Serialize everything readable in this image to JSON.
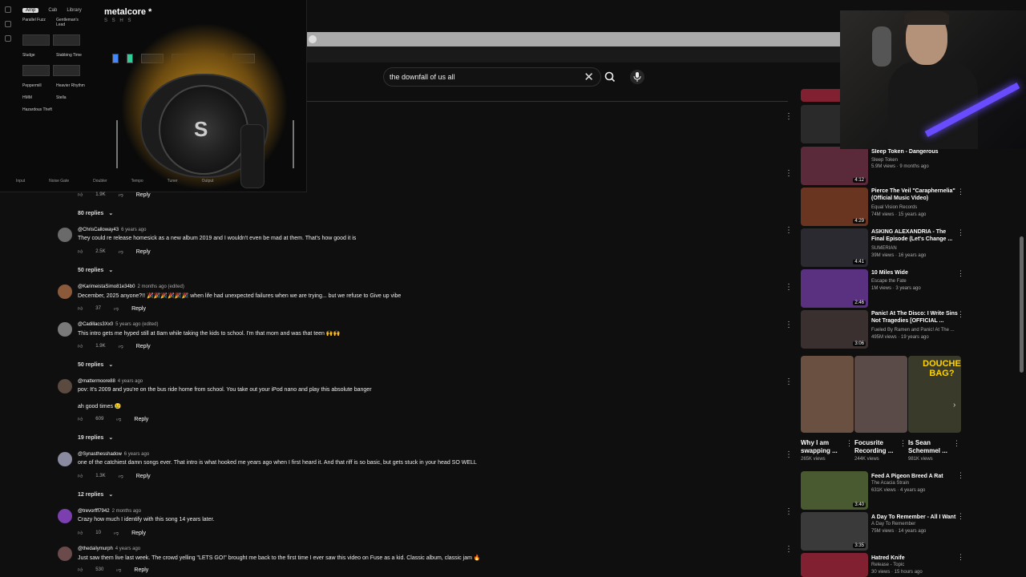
{
  "plugin": {
    "title": "metalcore *",
    "subtitle": "S  S  H  S",
    "tabs": [
      "Amp",
      "Cab",
      "Library"
    ],
    "presets": [
      {
        "a": "Parallel Fuzz",
        "b": "Gentleman's Lead"
      },
      {
        "a": "Sludge",
        "b": "Stabbing Time"
      },
      {
        "a": "Peppermill",
        "b": "Heavier Rhythm"
      },
      {
        "a": "HMM",
        "b": "Stella"
      },
      {
        "a": "Hazardous Theft",
        "b": ""
      }
    ],
    "logo": "S",
    "bottom_labels": [
      "Input",
      "Noise Gate",
      "Doubler",
      "Tempo",
      "Tuner",
      "Output"
    ]
  },
  "search": {
    "query": "the downfall of us all"
  },
  "comments": [
    {
      "id": "top",
      "likes": "1.9K",
      "reply": "Reply",
      "replies": "80 replies"
    },
    {
      "handle": "@ChrisCalloway43",
      "age": "6 years ago",
      "text": "They could re release homesick as a new album 2019 and I wouldn't even be mad at them. That's how good it is",
      "likes": "2.5K",
      "reply": "Reply",
      "replies": "50 replies"
    },
    {
      "handle": "@KarimeistaSimo81e34b0",
      "age": "2 months ago (edited)",
      "text": "December, 2025 anyone?!! 🎉🎉🎉🎉🎉🎉 when life had unexpected failures when we are trying... but we refuse to Give up vibe",
      "likes": "37",
      "reply": "Reply",
      "replies": ""
    },
    {
      "handle": "@Cadillacs3Xx0",
      "age": "5 years ago (edited)",
      "text": "This intro gets me hyped still at 8am while taking the kids to school. I'm that mom and was that teen 🙌🙌",
      "likes": "1.9K",
      "reply": "Reply",
      "replies": "50 replies"
    },
    {
      "handle": "@mattermoore88",
      "age": "4 years ago",
      "text": "pov: It's 2009 and you're on the bus ride home from school. You take out your iPod nano and play this absolute banger",
      "text2": "ah good times 😢",
      "likes": "609",
      "reply": "Reply",
      "replies": "19 replies"
    },
    {
      "handle": "@Synasthesshadow",
      "age": "6 years ago",
      "text": "one of the catchiest damn songs ever. That intro is what hooked me years ago when I first heard it. And that riff is so basic, but gets stuck in your head SO WELL",
      "likes": "1.3K",
      "reply": "Reply",
      "replies": "12 replies"
    },
    {
      "handle": "@trevorfff7942",
      "age": "2 months ago",
      "text": "Crazy how much I identify with this song 14 years later.",
      "likes": "10",
      "reply": "Reply",
      "replies": ""
    },
    {
      "handle": "@thedailymurph",
      "age": "4 years ago",
      "text": "Just saw them live last week. The crowd yelling \"LETS GO!\" brought me back to the first time I ever saw this video on Fuse as a kid. Classic album, classic jam 🔥",
      "likes": "530",
      "reply": "Reply",
      "replies": ""
    }
  ],
  "sidebar": [
    {
      "title": "Sleep Token - Dangerous",
      "channel": "Sleep Token",
      "meta": "5.9M views · 9 months ago",
      "duration": "4:12",
      "color": "#5a2a3a"
    },
    {
      "title": "Pierce The Veil \"Caraphernelia\" (Official Music Video)",
      "channel": "Equal Vision Records",
      "meta": "74M views · 15 years ago",
      "duration": "4:29",
      "color": "#6a3520"
    },
    {
      "title": "ASKING ALEXANDRIA - The Final Episode (Let's Change ...",
      "channel": "SUMERIAN",
      "meta": "39M views · 16 years ago",
      "duration": "4:41",
      "color": "#2a2a30"
    },
    {
      "title": "10 Miles Wide",
      "channel": "Escape the Fate",
      "meta": "1M views · 3 years ago",
      "duration": "2:46",
      "color": "#5a3080"
    },
    {
      "title": "Panic! At The Disco: I Write Sins Not Tragedies [OFFICIAL ...",
      "channel": "Fueled By Ramen and Panic! At The ...",
      "meta": "495M views · 19 years ago",
      "duration": "3:06",
      "color": "#3a3030"
    },
    {
      "title": "Feed A Pigeon Breed A Rat",
      "channel": "The Acacia Strain",
      "meta": "631K views · 4 years ago",
      "duration": "3:40",
      "color": "#4a5a30"
    },
    {
      "title": "A Day To Remember - All I Want",
      "channel": "A Day To Remember",
      "meta": "75M views · 14 years ago",
      "duration": "3:35",
      "color": "#3a3a3a"
    },
    {
      "title": "Hatred Knife",
      "channel": "Release - Topic",
      "meta": "30 views · 15 hours ago",
      "duration": "",
      "color": "#802030"
    }
  ],
  "shorts": [
    {
      "title": "Why I am swapping ...",
      "views": "265K views",
      "color": "#6a5040"
    },
    {
      "title": "Focusrite Recording ...",
      "views": "244K views",
      "color": "#5a4a48"
    },
    {
      "title": "Is Sean Schemmel ...",
      "views": "981K views",
      "color": "#3a3a2a",
      "overlay": "DOUCHE BAG?"
    }
  ],
  "colors": {
    "bg": "#0f0f0f",
    "accent": "#c89020",
    "link": "#3ea6ff"
  }
}
